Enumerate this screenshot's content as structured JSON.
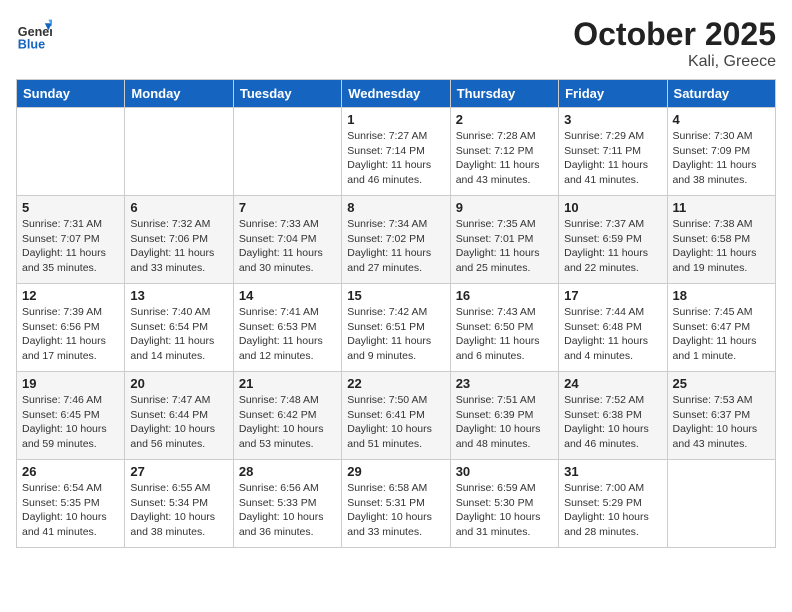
{
  "header": {
    "logo_general": "General",
    "logo_blue": "Blue",
    "month_title": "October 2025",
    "location": "Kali, Greece"
  },
  "days_of_week": [
    "Sunday",
    "Monday",
    "Tuesday",
    "Wednesday",
    "Thursday",
    "Friday",
    "Saturday"
  ],
  "weeks": [
    [
      {
        "day": "",
        "info": ""
      },
      {
        "day": "",
        "info": ""
      },
      {
        "day": "",
        "info": ""
      },
      {
        "day": "1",
        "info": "Sunrise: 7:27 AM\nSunset: 7:14 PM\nDaylight: 11 hours and 46 minutes."
      },
      {
        "day": "2",
        "info": "Sunrise: 7:28 AM\nSunset: 7:12 PM\nDaylight: 11 hours and 43 minutes."
      },
      {
        "day": "3",
        "info": "Sunrise: 7:29 AM\nSunset: 7:11 PM\nDaylight: 11 hours and 41 minutes."
      },
      {
        "day": "4",
        "info": "Sunrise: 7:30 AM\nSunset: 7:09 PM\nDaylight: 11 hours and 38 minutes."
      }
    ],
    [
      {
        "day": "5",
        "info": "Sunrise: 7:31 AM\nSunset: 7:07 PM\nDaylight: 11 hours and 35 minutes."
      },
      {
        "day": "6",
        "info": "Sunrise: 7:32 AM\nSunset: 7:06 PM\nDaylight: 11 hours and 33 minutes."
      },
      {
        "day": "7",
        "info": "Sunrise: 7:33 AM\nSunset: 7:04 PM\nDaylight: 11 hours and 30 minutes."
      },
      {
        "day": "8",
        "info": "Sunrise: 7:34 AM\nSunset: 7:02 PM\nDaylight: 11 hours and 27 minutes."
      },
      {
        "day": "9",
        "info": "Sunrise: 7:35 AM\nSunset: 7:01 PM\nDaylight: 11 hours and 25 minutes."
      },
      {
        "day": "10",
        "info": "Sunrise: 7:37 AM\nSunset: 6:59 PM\nDaylight: 11 hours and 22 minutes."
      },
      {
        "day": "11",
        "info": "Sunrise: 7:38 AM\nSunset: 6:58 PM\nDaylight: 11 hours and 19 minutes."
      }
    ],
    [
      {
        "day": "12",
        "info": "Sunrise: 7:39 AM\nSunset: 6:56 PM\nDaylight: 11 hours and 17 minutes."
      },
      {
        "day": "13",
        "info": "Sunrise: 7:40 AM\nSunset: 6:54 PM\nDaylight: 11 hours and 14 minutes."
      },
      {
        "day": "14",
        "info": "Sunrise: 7:41 AM\nSunset: 6:53 PM\nDaylight: 11 hours and 12 minutes."
      },
      {
        "day": "15",
        "info": "Sunrise: 7:42 AM\nSunset: 6:51 PM\nDaylight: 11 hours and 9 minutes."
      },
      {
        "day": "16",
        "info": "Sunrise: 7:43 AM\nSunset: 6:50 PM\nDaylight: 11 hours and 6 minutes."
      },
      {
        "day": "17",
        "info": "Sunrise: 7:44 AM\nSunset: 6:48 PM\nDaylight: 11 hours and 4 minutes."
      },
      {
        "day": "18",
        "info": "Sunrise: 7:45 AM\nSunset: 6:47 PM\nDaylight: 11 hours and 1 minute."
      }
    ],
    [
      {
        "day": "19",
        "info": "Sunrise: 7:46 AM\nSunset: 6:45 PM\nDaylight: 10 hours and 59 minutes."
      },
      {
        "day": "20",
        "info": "Sunrise: 7:47 AM\nSunset: 6:44 PM\nDaylight: 10 hours and 56 minutes."
      },
      {
        "day": "21",
        "info": "Sunrise: 7:48 AM\nSunset: 6:42 PM\nDaylight: 10 hours and 53 minutes."
      },
      {
        "day": "22",
        "info": "Sunrise: 7:50 AM\nSunset: 6:41 PM\nDaylight: 10 hours and 51 minutes."
      },
      {
        "day": "23",
        "info": "Sunrise: 7:51 AM\nSunset: 6:39 PM\nDaylight: 10 hours and 48 minutes."
      },
      {
        "day": "24",
        "info": "Sunrise: 7:52 AM\nSunset: 6:38 PM\nDaylight: 10 hours and 46 minutes."
      },
      {
        "day": "25",
        "info": "Sunrise: 7:53 AM\nSunset: 6:37 PM\nDaylight: 10 hours and 43 minutes."
      }
    ],
    [
      {
        "day": "26",
        "info": "Sunrise: 6:54 AM\nSunset: 5:35 PM\nDaylight: 10 hours and 41 minutes."
      },
      {
        "day": "27",
        "info": "Sunrise: 6:55 AM\nSunset: 5:34 PM\nDaylight: 10 hours and 38 minutes."
      },
      {
        "day": "28",
        "info": "Sunrise: 6:56 AM\nSunset: 5:33 PM\nDaylight: 10 hours and 36 minutes."
      },
      {
        "day": "29",
        "info": "Sunrise: 6:58 AM\nSunset: 5:31 PM\nDaylight: 10 hours and 33 minutes."
      },
      {
        "day": "30",
        "info": "Sunrise: 6:59 AM\nSunset: 5:30 PM\nDaylight: 10 hours and 31 minutes."
      },
      {
        "day": "31",
        "info": "Sunrise: 7:00 AM\nSunset: 5:29 PM\nDaylight: 10 hours and 28 minutes."
      },
      {
        "day": "",
        "info": ""
      }
    ]
  ]
}
